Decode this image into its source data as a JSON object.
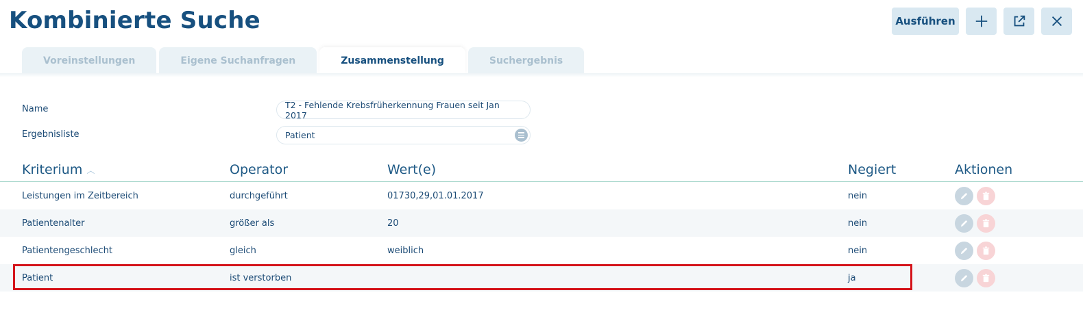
{
  "header": {
    "title": "Kombinierte Suche",
    "run_label": "Ausführen",
    "buttons": [
      "plus-icon",
      "external-link-icon",
      "close-icon"
    ]
  },
  "tabs": [
    {
      "label": "Voreinstellungen",
      "active": false
    },
    {
      "label": "Eigene Suchanfragen",
      "active": false
    },
    {
      "label": "Zusammenstellung",
      "active": true
    },
    {
      "label": "Suchergebnis",
      "active": false
    }
  ],
  "form": {
    "name_label": "Name",
    "name_value": "T2 - Fehlende Krebsfrüherkennung Frauen seit Jan 2017",
    "result_label": "Ergebnisliste",
    "result_value": "Patient"
  },
  "table": {
    "headers": {
      "kriterium": "Kriterium",
      "operator": "Operator",
      "werte": "Wert(e)",
      "negiert": "Negiert",
      "aktionen": "Aktionen"
    },
    "rows": [
      {
        "kriterium": "Leistungen im Zeitbereich",
        "operator": "durchgeführt",
        "wert": "01730,29,01.01.2017",
        "negiert": "nein"
      },
      {
        "kriterium": "Patientenalter",
        "operator": "größer als",
        "wert": "20",
        "negiert": "nein"
      },
      {
        "kriterium": "Patientengeschlecht",
        "operator": "gleich",
        "wert": "weiblich",
        "negiert": "nein"
      },
      {
        "kriterium": "Patient",
        "operator": "ist verstorben",
        "wert": "",
        "negiert": "ja"
      }
    ]
  },
  "colors": {
    "primary": "#17507f",
    "highlight": "#d4141b",
    "button_bg": "#d9e8f1"
  }
}
